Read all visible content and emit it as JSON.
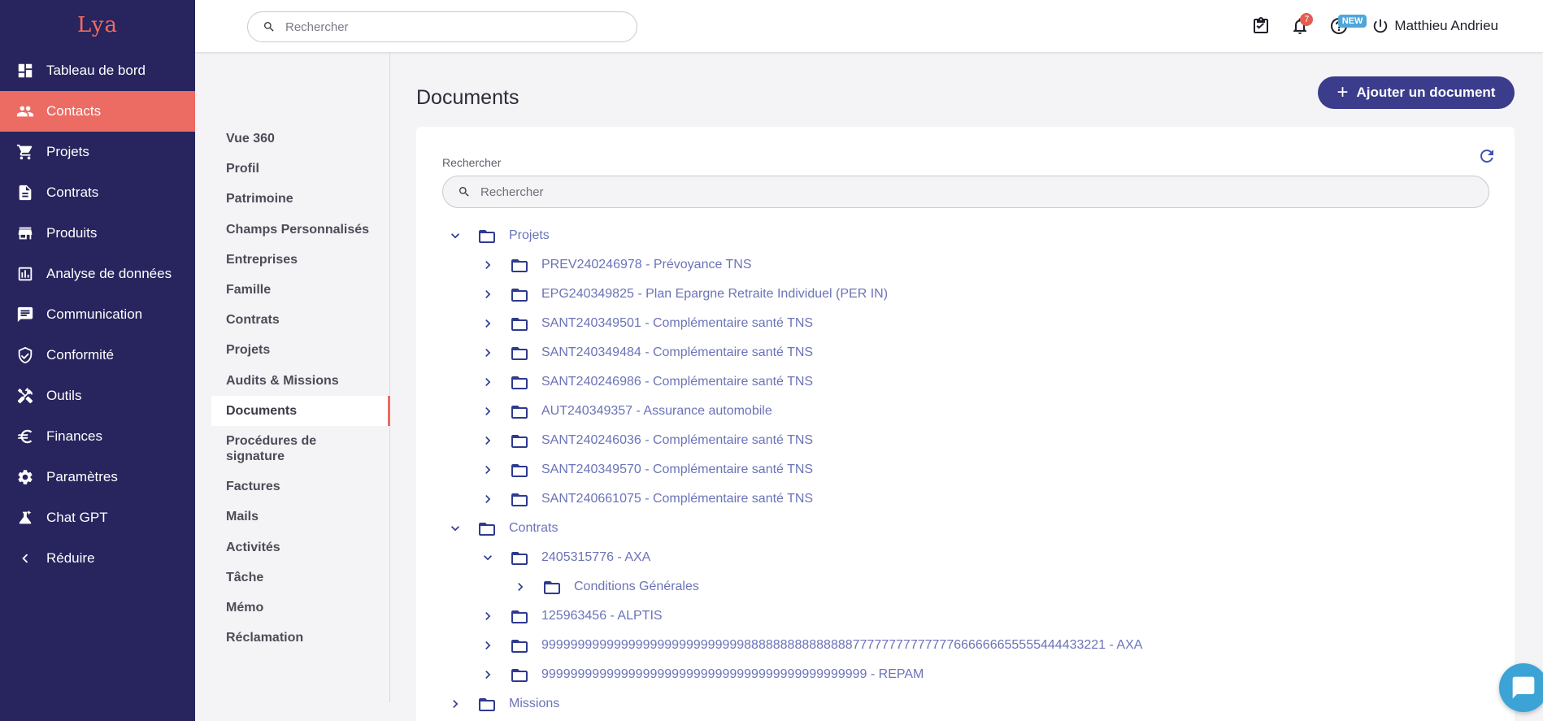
{
  "app": {
    "logo_text": "Lya"
  },
  "sidebar": {
    "items": [
      {
        "label": "Tableau de bord",
        "icon": "dashboard-icon"
      },
      {
        "label": "Contacts",
        "icon": "people-icon",
        "active": true
      },
      {
        "label": "Projets",
        "icon": "cart-icon"
      },
      {
        "label": "Contrats",
        "icon": "document-icon"
      },
      {
        "label": "Produits",
        "icon": "store-icon"
      },
      {
        "label": "Analyse de données",
        "icon": "chart-icon"
      },
      {
        "label": "Communication",
        "icon": "message-icon"
      },
      {
        "label": "Conformité",
        "icon": "shield-icon"
      },
      {
        "label": "Outils",
        "icon": "tools-icon"
      },
      {
        "label": "Finances",
        "icon": "euro-icon"
      },
      {
        "label": "Paramètres",
        "icon": "gear-icon"
      },
      {
        "label": "Chat GPT",
        "icon": "flask-icon"
      },
      {
        "label": "Réduire",
        "icon": "chevron-left-icon"
      }
    ]
  },
  "topbar": {
    "search_placeholder": "Rechercher",
    "notifications_count": "7",
    "new_badge": "NEW",
    "user_name": "Matthieu Andrieu"
  },
  "subnav": {
    "items": [
      {
        "label": "Vue 360"
      },
      {
        "label": "Profil"
      },
      {
        "label": "Patrimoine"
      },
      {
        "label": "Champs Personnalisés"
      },
      {
        "label": "Entreprises"
      },
      {
        "label": "Famille"
      },
      {
        "label": "Contrats"
      },
      {
        "label": "Projets"
      },
      {
        "label": "Audits & Missions"
      },
      {
        "label": "Documents",
        "active": true
      },
      {
        "label": "Procédures de signature"
      },
      {
        "label": "Factures"
      },
      {
        "label": "Mails"
      },
      {
        "label": "Activités"
      },
      {
        "label": "Tâche"
      },
      {
        "label": "Mémo"
      },
      {
        "label": "Réclamation"
      }
    ]
  },
  "main": {
    "title": "Documents",
    "add_button_label": "Ajouter un document",
    "search_label": "Rechercher",
    "search_placeholder": "Rechercher",
    "tree": [
      {
        "level": 0,
        "expanded": true,
        "label": "Projets"
      },
      {
        "level": 1,
        "expanded": false,
        "label": "PREV240246978 - Prévoyance TNS"
      },
      {
        "level": 1,
        "expanded": false,
        "label": "EPG240349825 - Plan Epargne Retraite Individuel (PER IN)"
      },
      {
        "level": 1,
        "expanded": false,
        "label": "SANT240349501 - Complémentaire santé TNS"
      },
      {
        "level": 1,
        "expanded": false,
        "label": "SANT240349484 - Complémentaire santé TNS"
      },
      {
        "level": 1,
        "expanded": false,
        "label": "SANT240246986 - Complémentaire santé TNS"
      },
      {
        "level": 1,
        "expanded": false,
        "label": "AUT240349357 - Assurance automobile"
      },
      {
        "level": 1,
        "expanded": false,
        "label": "SANT240246036 - Complémentaire santé TNS"
      },
      {
        "level": 1,
        "expanded": false,
        "label": "SANT240349570 - Complémentaire santé TNS"
      },
      {
        "level": 1,
        "expanded": false,
        "label": "SANT240661075 - Complémentaire santé TNS"
      },
      {
        "level": 0,
        "expanded": true,
        "label": "Contrats"
      },
      {
        "level": 1,
        "expanded": true,
        "label": "2405315776 - AXA"
      },
      {
        "level": 2,
        "expanded": false,
        "label": "Conditions Générales"
      },
      {
        "level": 1,
        "expanded": false,
        "label": "125963456 - ALPTIS"
      },
      {
        "level": 1,
        "expanded": false,
        "label": "999999999999999999999999999988888888888888877777777777777666666655555444433221 - AXA"
      },
      {
        "level": 1,
        "expanded": false,
        "label": "999999999999999999999999999999999999999999999 - REPAM"
      },
      {
        "level": 0,
        "expanded": false,
        "label": "Missions"
      }
    ]
  }
}
